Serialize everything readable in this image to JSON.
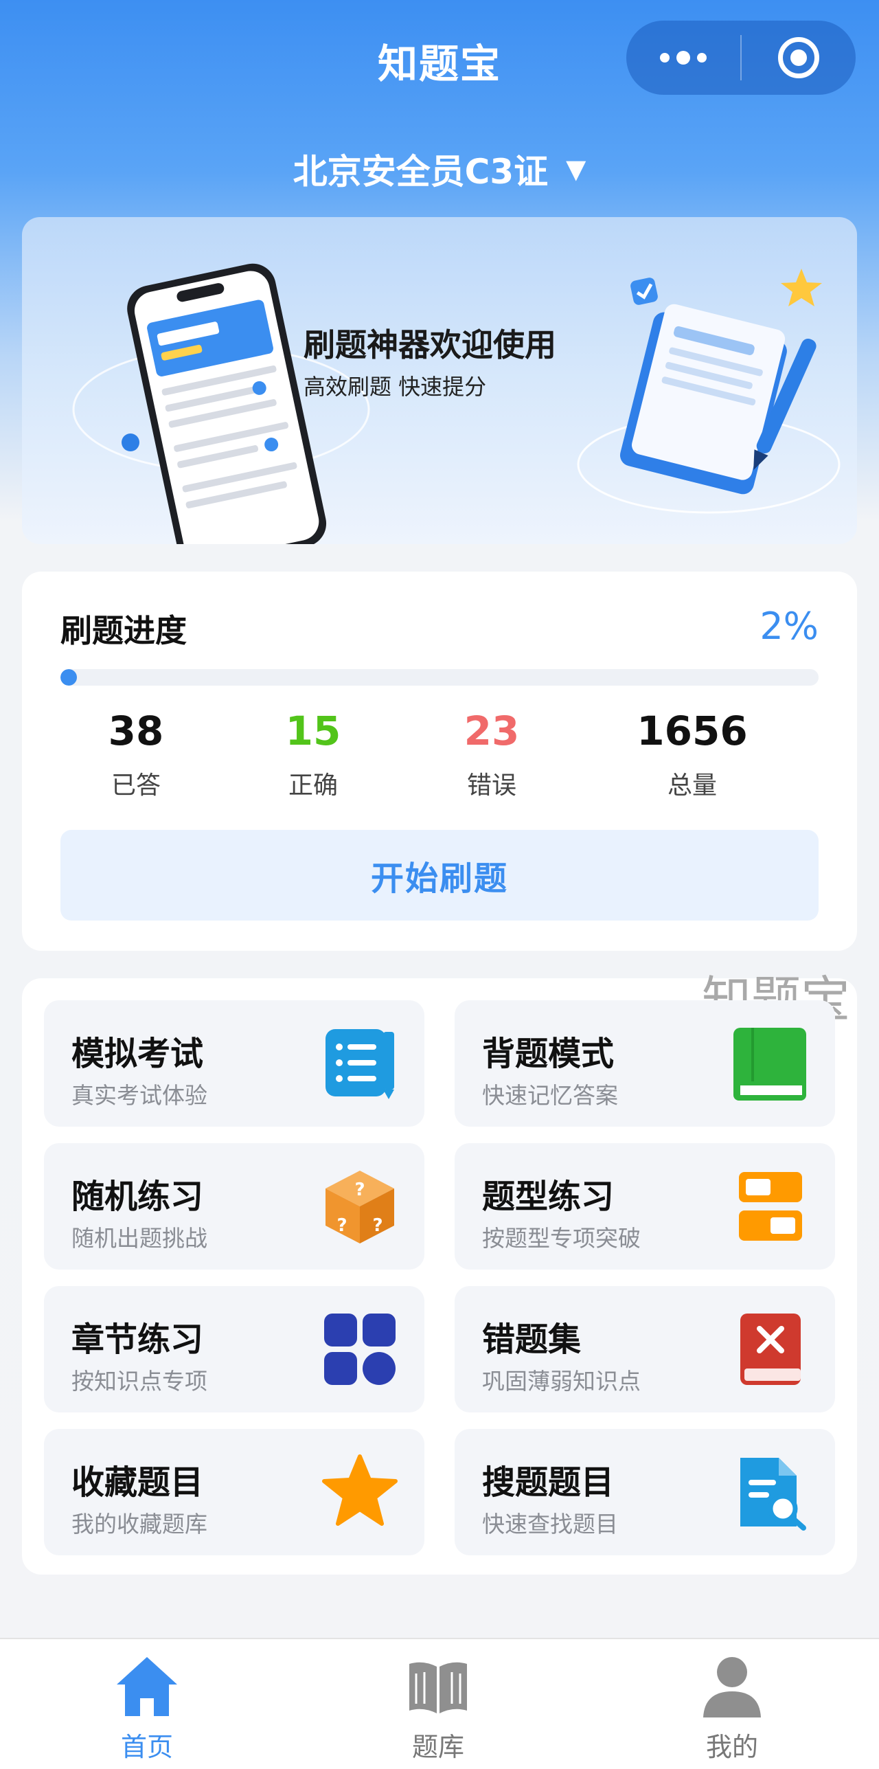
{
  "app": {
    "title": "知题宝"
  },
  "exam_selector": {
    "label": "北京安全员C3证",
    "caret": "▼"
  },
  "banner": {
    "title": "刷题神器欢迎使用",
    "subtitle": "高效刷题  快速提分"
  },
  "progress": {
    "label": "刷题进度",
    "percent_text": "2%",
    "fill_fraction": 0.02,
    "stats": [
      {
        "value": "38",
        "label": "已答",
        "color": "#111111"
      },
      {
        "value": "15",
        "label": "正确",
        "color": "#52c41a"
      },
      {
        "value": "23",
        "label": "错误",
        "color": "#f06a6a"
      },
      {
        "value": "1656",
        "label": "总量",
        "color": "#111111"
      }
    ],
    "start_button": "开始刷题"
  },
  "watermark": "知题宝",
  "features": [
    {
      "title": "模拟考试",
      "subtitle": "真实考试体验",
      "icon": "list-document-icon",
      "color": "#1f9be0"
    },
    {
      "title": "背题模式",
      "subtitle": "快速记忆答案",
      "icon": "green-book-icon",
      "color": "#2eb33c"
    },
    {
      "title": "随机练习",
      "subtitle": "随机出题挑战",
      "icon": "dice-icon",
      "color": "#f0952e"
    },
    {
      "title": "题型练习",
      "subtitle": "按题型专项突破",
      "icon": "toggle-blocks-icon",
      "color": "#ff9a00"
    },
    {
      "title": "章节练习",
      "subtitle": "按知识点专项",
      "icon": "grid-apps-icon",
      "color": "#2b3fb0"
    },
    {
      "title": "错题集",
      "subtitle": "巩固薄弱知识点",
      "icon": "wrong-book-icon",
      "color": "#cf3a2e"
    },
    {
      "title": "收藏题目",
      "subtitle": "我的收藏题库",
      "icon": "star-icon",
      "color": "#ff9a00"
    },
    {
      "title": "搜题题目",
      "subtitle": "快速查找题目",
      "icon": "search-document-icon",
      "color": "#1f9be0"
    }
  ],
  "tabs": [
    {
      "label": "首页",
      "icon": "home-icon",
      "active": true
    },
    {
      "label": "题库",
      "icon": "open-book-icon",
      "active": false
    },
    {
      "label": "我的",
      "icon": "user-icon",
      "active": false
    }
  ],
  "colors": {
    "primary": "#3b8ef0",
    "correct": "#52c41a",
    "wrong": "#f06a6a"
  }
}
